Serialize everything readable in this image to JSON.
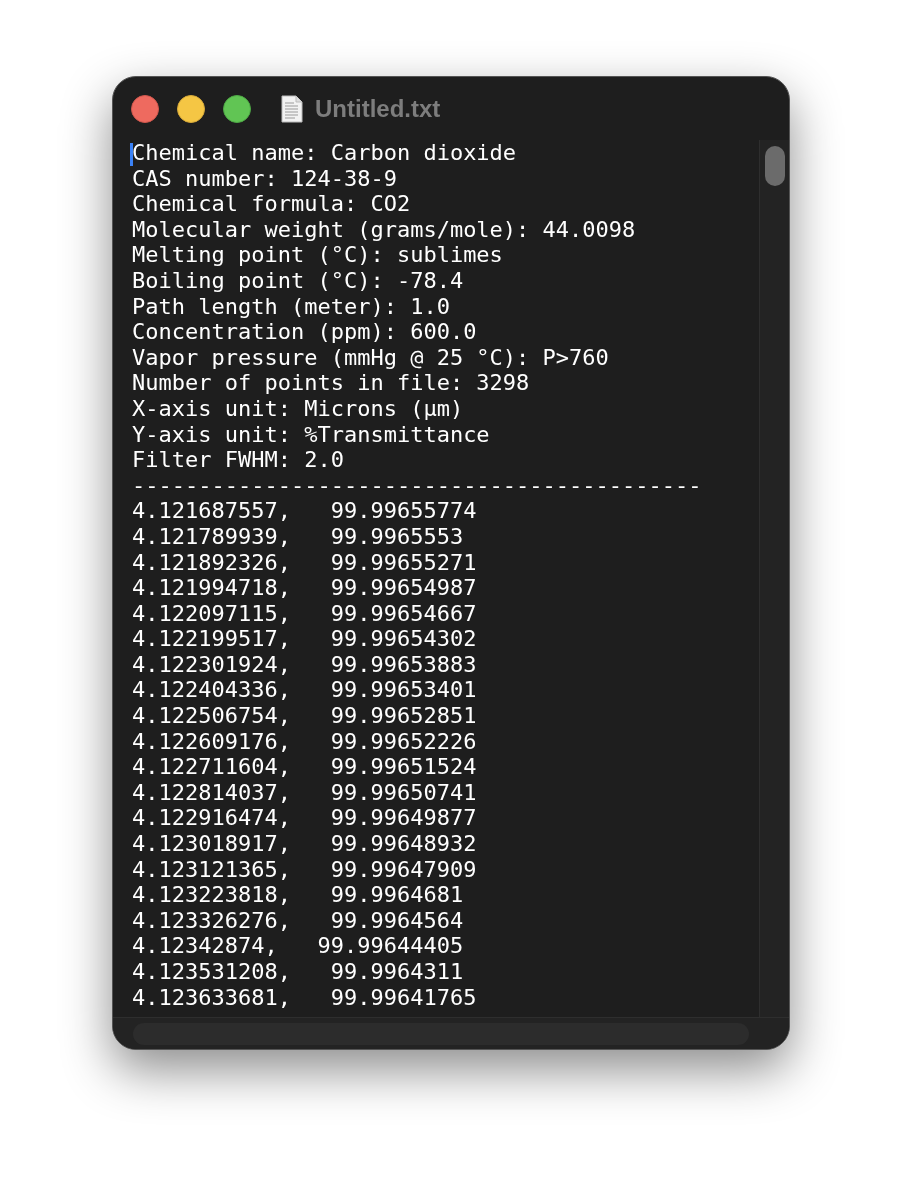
{
  "window": {
    "title": "Untitled.txt"
  },
  "lines": [
    "Chemical name: Carbon dioxide",
    "CAS number: 124-38-9",
    "Chemical formula: CO2",
    "Molecular weight (grams/mole): 44.0098",
    "Melting point (°C): sublimes",
    "Boiling point (°C): -78.4",
    "Path length (meter): 1.0",
    "Concentration (ppm): 600.0",
    "Vapor pressure (mmHg @ 25 °C): P>760",
    "Number of points in file: 3298",
    "X-axis unit: Microns (µm)",
    "Y-axis unit: %Transmittance",
    "Filter FWHM: 2.0",
    "-------------------------------------------",
    "4.121687557,   99.99655774",
    "4.121789939,   99.9965553",
    "4.121892326,   99.99655271",
    "4.121994718,   99.99654987",
    "4.122097115,   99.99654667",
    "4.122199517,   99.99654302",
    "4.122301924,   99.99653883",
    "4.122404336,   99.99653401",
    "4.122506754,   99.99652851",
    "4.122609176,   99.99652226",
    "4.122711604,   99.99651524",
    "4.122814037,   99.99650741",
    "4.122916474,   99.99649877",
    "4.123018917,   99.99648932",
    "4.123121365,   99.99647909",
    "4.123223818,   99.9964681",
    "4.123326276,   99.9964564",
    "4.12342874,   99.99644405",
    "4.123531208,   99.9964311",
    "4.123633681,   99.99641765"
  ]
}
